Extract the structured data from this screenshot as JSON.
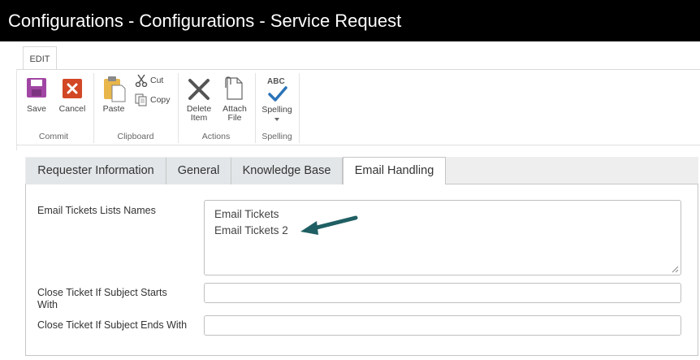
{
  "window": {
    "title": "Configurations - Configurations - Service Request"
  },
  "ribbon": {
    "tab": "EDIT",
    "groups": {
      "commit": {
        "label": "Commit",
        "save": "Save",
        "cancel": "Cancel"
      },
      "clipboard": {
        "label": "Clipboard",
        "paste": "Paste",
        "cut": "Cut",
        "copy": "Copy"
      },
      "actions": {
        "label": "Actions",
        "delete_line1": "Delete",
        "delete_line2": "Item",
        "attach_line1": "Attach",
        "attach_line2": "File"
      },
      "spelling": {
        "label": "Spelling",
        "spelling": "Spelling",
        "abc": "ABC"
      }
    }
  },
  "tabs": [
    "Requester Information",
    "General",
    "Knowledge Base",
    "Email Handling"
  ],
  "active_tab": "Email Handling",
  "form": {
    "email_lists_label": "Email Tickets Lists Names",
    "email_lists_values": [
      "Email Tickets",
      "Email Tickets 2"
    ],
    "subject_starts_label": "Close Ticket If Subject Starts With",
    "subject_starts_value": "",
    "subject_ends_label": "Close Ticket If Subject Ends With",
    "subject_ends_value": ""
  },
  "icons": [
    "save-icon",
    "cancel-icon",
    "paste-icon",
    "cut-icon",
    "copy-icon",
    "delete-item-icon",
    "attach-file-icon",
    "spelling-icon",
    "dropdown-arrow-icon",
    "annotation-arrow",
    "resize-handle-icon"
  ],
  "colors": {
    "titlebar": "#000000",
    "save": "#a146a4",
    "cancel": "#d24726",
    "spelling_check": "#2b73b7",
    "arrow": "#1f5f63"
  }
}
